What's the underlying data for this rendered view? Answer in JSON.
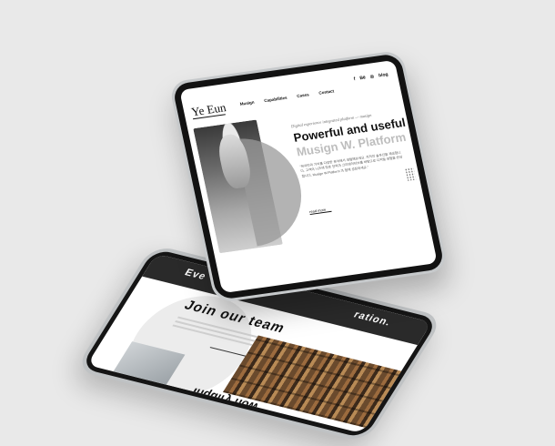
{
  "back_tablet": {
    "top_text_left": "Eve",
    "top_text_right": "ration.",
    "join_title": "Join our team",
    "bottom_text": "Inquiry now"
  },
  "front_tablet": {
    "logo": "Ye Eun",
    "nav": [
      "Musign",
      "Capabilities",
      "Cases",
      "Contact"
    ],
    "social": {
      "facebook": "f",
      "behance": "Bē",
      "instagram": "◎",
      "blog": "blog"
    },
    "tagline": "Digital experience integrated platform — musign",
    "headline_line1": "Powerful and useful",
    "headline_line2": "Musign W. Platform",
    "body": "\"뮤자인의 가치를 다양한 분야에서 경험해보세요. 최적의 솔루션을 제공합니다. 고객의 니즈에 맞춘 전략과 크리에이티브를 바탕으로 디지털 경험을 완성합니다. Musign W.Platform 과 함께 성장하세요.\"",
    "read_more": "read more"
  },
  "colors": {
    "background": "#e9e9e9",
    "bezel": "#121212",
    "headline_dark": "#111111",
    "headline_light": "#bdbdbd"
  }
}
